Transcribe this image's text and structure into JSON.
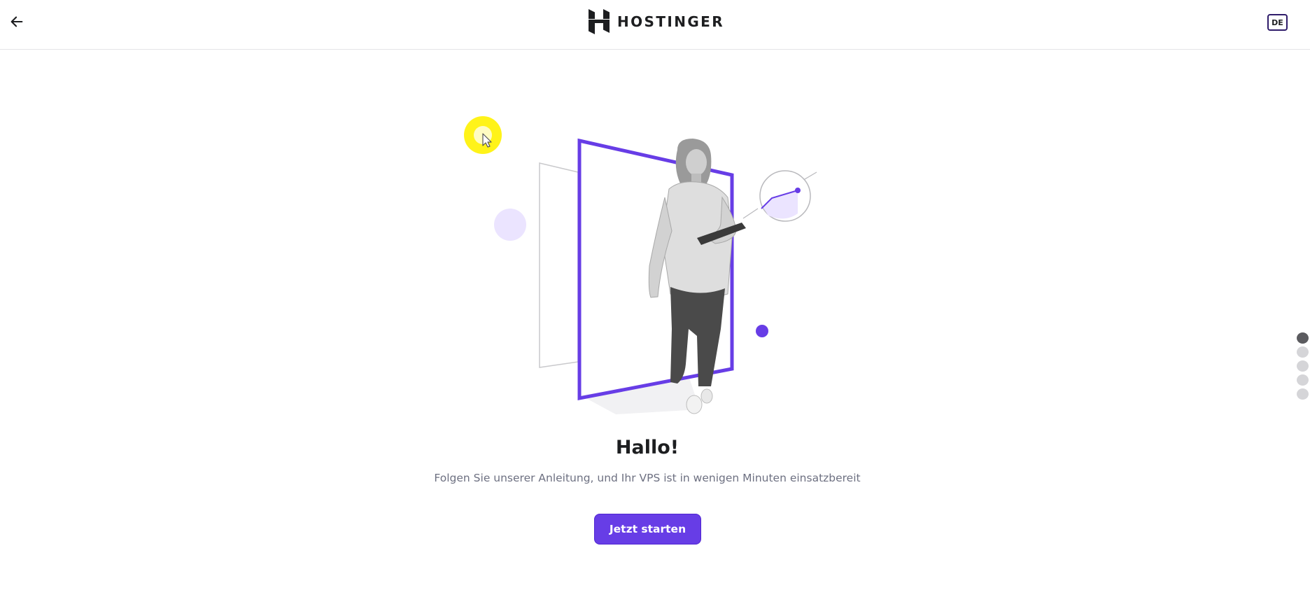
{
  "header": {
    "back_icon": "arrow-left-icon",
    "logo_icon": "hostinger-h-logo-icon",
    "brand_name": "HOSTINGER",
    "language_code": "DE"
  },
  "hero": {
    "title": "Hallo!",
    "subtitle": "Folgen Sie unserer Anleitung, und Ihr VPS ist in wenigen Minuten einsatzbereit",
    "start_button_label": "Jetzt starten"
  },
  "pager": {
    "total_steps": 5,
    "active_step": 1
  },
  "colors": {
    "accent": "#673de6",
    "accent_light": "#ebe4ff",
    "text_primary": "#1d1e20",
    "text_secondary": "#6d7081",
    "cursor_highlight": "#fff200"
  }
}
